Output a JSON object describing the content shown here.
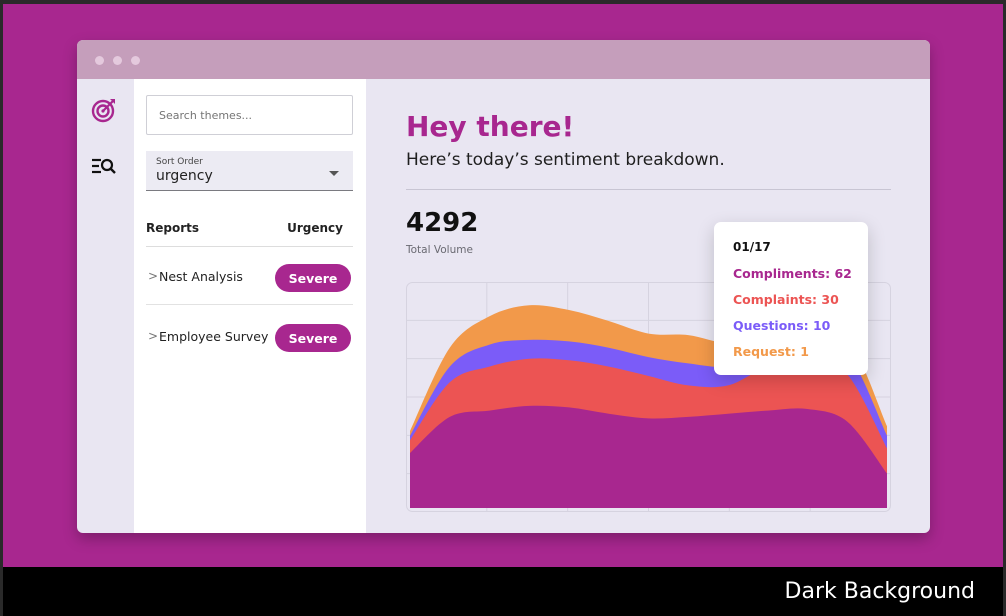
{
  "caption": "Dark Background",
  "colors": {
    "brand": "#a8278f",
    "compliments": "#a8278f",
    "complaints": "#ec5453",
    "questions": "#7b5cf8",
    "request": "#f2994a"
  },
  "rail": {
    "icons": [
      "target-icon",
      "list-search-icon"
    ]
  },
  "panel": {
    "search_placeholder": "Search themes...",
    "sort_label": "Sort Order",
    "sort_value": "urgency",
    "col_reports": "Reports",
    "col_urgency": "Urgency",
    "items": [
      {
        "label": "Nest Analysis",
        "badge": "Severe"
      },
      {
        "label": "Employee Survey",
        "badge": "Severe"
      }
    ]
  },
  "main": {
    "headline": "Hey there!",
    "subhead": "Here’s today’s sentiment breakdown.",
    "total_value": "4292",
    "total_label": "Total Volume"
  },
  "tooltip": {
    "date": "01/17",
    "compliments": "Compliments: 62",
    "complaints": "Complaints: 30",
    "questions": "Questions: 10",
    "request": "Request: 1"
  },
  "chart_data": {
    "type": "area",
    "stacked": true,
    "grid": true,
    "x": [
      0,
      1,
      2,
      3,
      4,
      5,
      6,
      7,
      8,
      9,
      10,
      11,
      12
    ],
    "series": [
      {
        "name": "Compliments",
        "values": [
          35,
          58,
          62,
          65,
          64,
          60,
          57,
          58,
          60,
          62,
          63,
          55,
          22
        ]
      },
      {
        "name": "Complaints",
        "values": [
          8,
          22,
          28,
          30,
          30,
          30,
          27,
          20,
          18,
          28,
          32,
          30,
          16
        ]
      },
      {
        "name": "Questions",
        "values": [
          3,
          10,
          14,
          12,
          12,
          12,
          12,
          14,
          12,
          8,
          10,
          14,
          8
        ]
      },
      {
        "name": "Request",
        "values": [
          3,
          12,
          18,
          22,
          20,
          17,
          15,
          18,
          15,
          12,
          10,
          10,
          6
        ]
      }
    ],
    "ylim": [
      0,
      140
    ]
  }
}
